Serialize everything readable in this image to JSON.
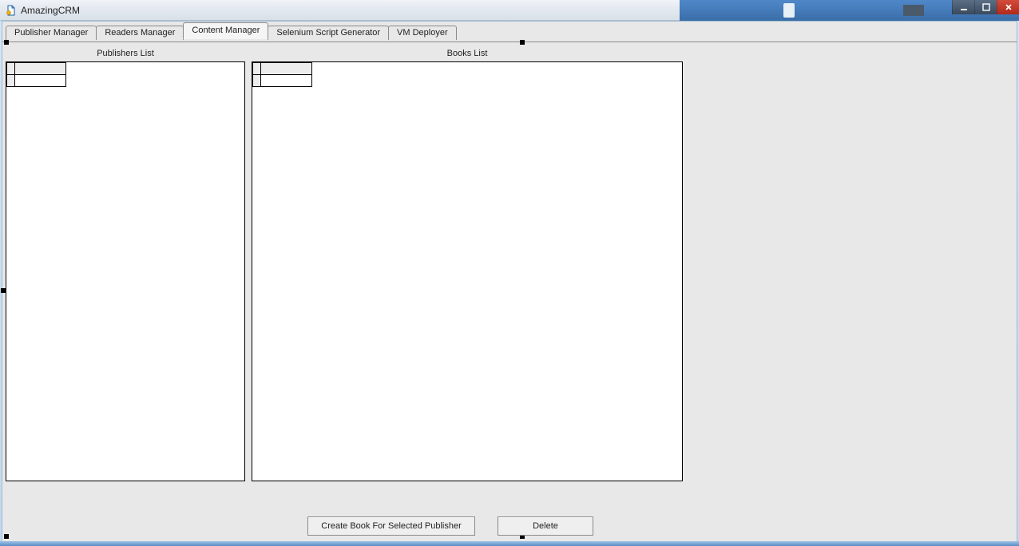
{
  "window": {
    "title": "AmazingCRM"
  },
  "tabs": [
    {
      "label": "Publisher Manager",
      "active": false
    },
    {
      "label": "Readers Manager",
      "active": false
    },
    {
      "label": "Content Manager",
      "active": true
    },
    {
      "label": "Selenium Script Generator",
      "active": false
    },
    {
      "label": "VM Deployer",
      "active": false
    }
  ],
  "content_manager": {
    "publishers_header": "Publishers List",
    "books_header": "Books List",
    "create_button": "Create Book For Selected Publisher",
    "delete_button": "Delete"
  }
}
